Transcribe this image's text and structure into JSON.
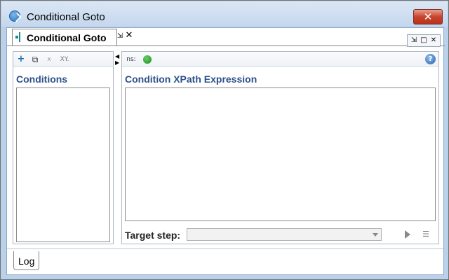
{
  "window": {
    "title": "Conditional Goto",
    "close_glyph": "✕",
    "icon": "app-logo-icon"
  },
  "editor_tab": {
    "label": "Conditional Goto",
    "icon": "step-icon",
    "restore_glyph": "⇲",
    "close_glyph": "✕"
  },
  "view_controls": {
    "restore_glyph": "⇲",
    "maximize_glyph": "□",
    "close_glyph": "✕"
  },
  "conditions_panel": {
    "title": "Conditions",
    "toolbar": {
      "add_label": "+",
      "copy_label": "⧉",
      "delete_label": "x",
      "xy_label": "XY."
    }
  },
  "xpath_panel": {
    "title": "Condition XPath Expression",
    "ns_label": "ns:",
    "help_glyph": "?"
  },
  "target": {
    "label": "Target step:",
    "selected_value": ""
  },
  "bottom": {
    "log_tab_label": "Log"
  }
}
